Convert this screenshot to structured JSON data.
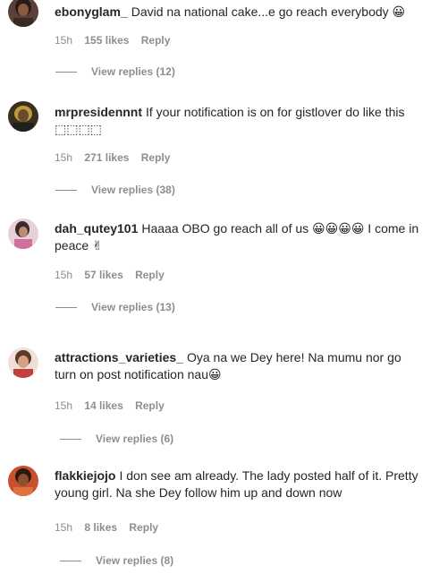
{
  "comments": [
    {
      "username": "ebonyglam_",
      "text": "David na national cake...e go reach everybody 😀",
      "time": "15h",
      "likes": "155 likes",
      "reply": "Reply",
      "view_replies": "View replies (12)",
      "avatar_color": "#3b2a26"
    },
    {
      "username": "mrpresidennnt",
      "text": "If your notification is on for gistlover do like this ⬚⬚⬚⬚",
      "time": "15h",
      "likes": "271 likes",
      "reply": "Reply",
      "view_replies": "View replies (38)",
      "avatar_color": "#4a3a1a"
    },
    {
      "username": "dah_qutey101",
      "text": "Haaaa OBO go reach all of us 😀😀😀😀 I come in peace ✌",
      "time": "15h",
      "likes": "57 likes",
      "reply": "Reply",
      "view_replies": "View replies (13)",
      "avatar_color": "#d9a7b8"
    },
    {
      "username": "attractions_varieties_",
      "text": "Oya na we Dey here! Na mumu nor go turn on post notification nau😀",
      "time": "15h",
      "likes": "14 likes",
      "reply": "Reply",
      "view_replies": "View replies (6)",
      "avatar_color": "#e0c0b0"
    },
    {
      "username": "flakkiejojo",
      "text": "I don see am already. The lady posted half of it. Pretty young girl. Na she Dey follow him up and down now",
      "time": "15h",
      "likes": "8 likes",
      "reply": "Reply",
      "view_replies": "View replies (8)",
      "avatar_color": "#b04030"
    }
  ]
}
